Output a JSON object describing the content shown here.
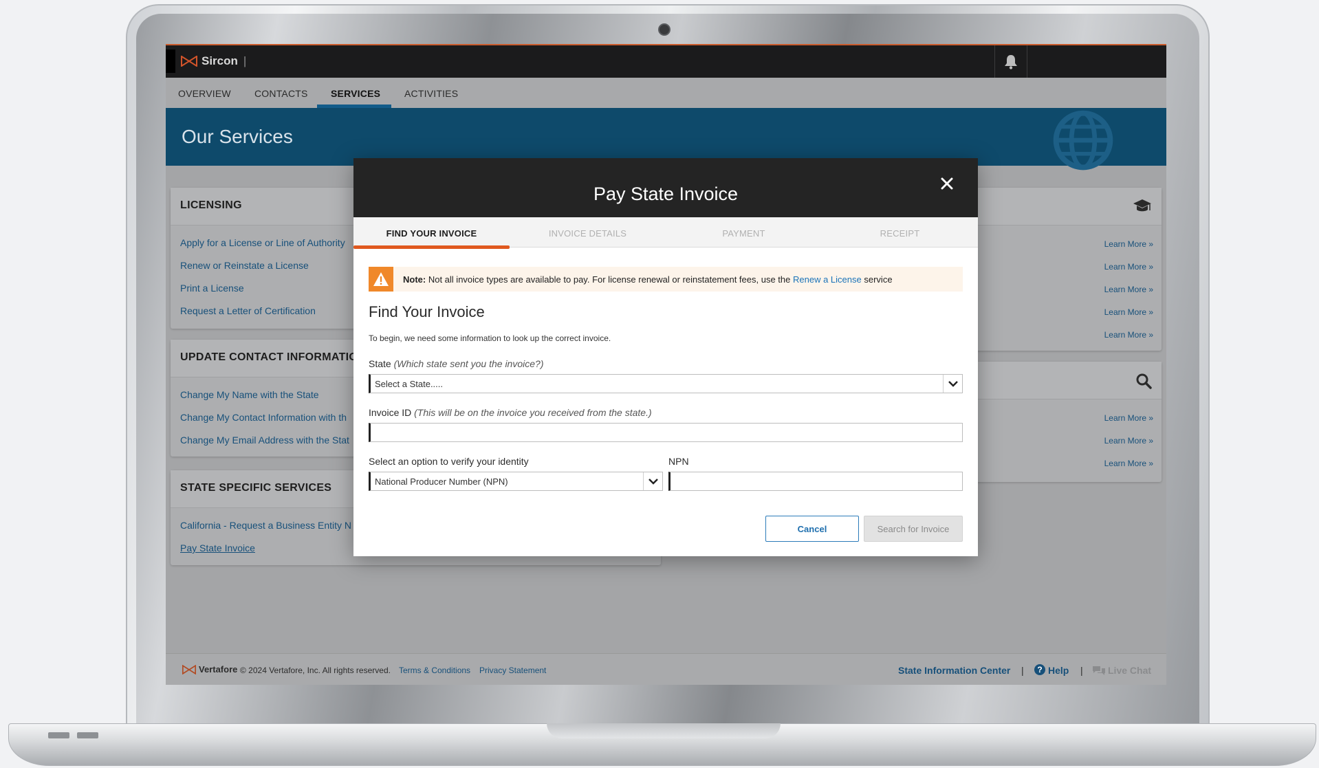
{
  "app": {
    "brand": "Sircon",
    "tabs": [
      "OVERVIEW",
      "CONTACTS",
      "SERVICES",
      "ACTIVITIES"
    ],
    "active_tab": "SERVICES",
    "page_title": "Our Services"
  },
  "panels": {
    "licensing": {
      "title": "LICENSING",
      "links": [
        "Apply for a License or Line of Authority",
        "Renew or Reinstate a License",
        "Print a License",
        "Request a Letter of Certification"
      ]
    },
    "contact": {
      "title": "UPDATE CONTACT INFORMATION",
      "links": [
        "Change My Name with the State",
        "Change My Contact Information with th",
        "Change My Email Address with the Stat"
      ]
    },
    "state_specific": {
      "title": "STATE SPECIFIC SERVICES",
      "links": [
        "California - Request a Business Entity N",
        "Pay State Invoice"
      ]
    },
    "learn_more": "Learn More"
  },
  "modal": {
    "title": "Pay State Invoice",
    "steps": [
      "FIND YOUR INVOICE",
      "INVOICE DETAILS",
      "PAYMENT",
      "RECEIPT"
    ],
    "note_label": "Note:",
    "note_text": "Not all invoice types are available to pay. For license renewal or reinstatement fees, use the",
    "note_link": "Renew a License",
    "note_suffix": "service",
    "heading": "Find Your Invoice",
    "intro": "To begin, we need some information to look up the correct invoice.",
    "state_label": "State",
    "state_hint": "(Which state sent you the invoice?)",
    "state_placeholder": "Select a State.....",
    "invoice_label": "Invoice ID",
    "invoice_hint": "(This will be on the invoice you received from the state.)",
    "invoice_value": "",
    "verify_label": "Select an option to verify your identity",
    "verify_value": "National Producer Number (NPN)",
    "npn_label": "NPN",
    "npn_value": "",
    "cancel": "Cancel",
    "search": "Search for Invoice"
  },
  "footer": {
    "brand": "Vertafore",
    "copyright": "© 2024 Vertafore, Inc. All rights reserved.",
    "terms": "Terms & Conditions",
    "privacy": "Privacy Statement",
    "state_center": "State Information Center",
    "help": "Help",
    "live_chat": "Live Chat",
    "separator": "|"
  },
  "colors": {
    "brand_orange": "#e0591f",
    "header_blue": "#0e4a6b",
    "link_blue": "#1a73b8"
  }
}
